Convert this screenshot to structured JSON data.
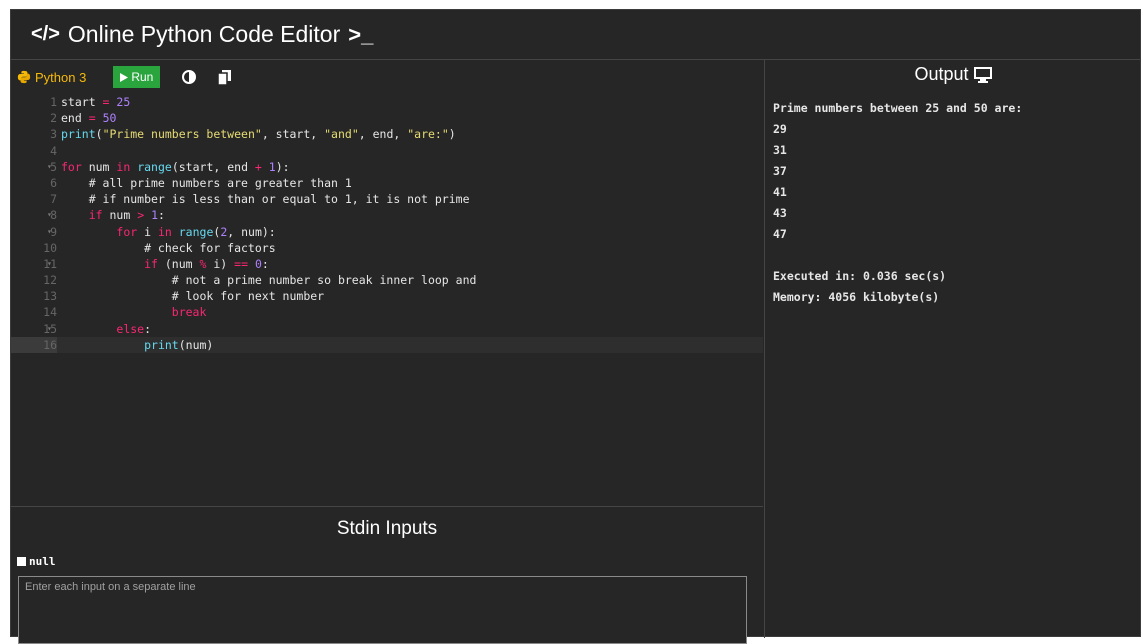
{
  "header": {
    "title": "Online Python Code Editor",
    "brand_icon": "</>",
    "terminal_icon": ">_"
  },
  "toolbar": {
    "language": "Python 3",
    "run_label": "Run"
  },
  "editor": {
    "lines": [
      {
        "n": "1",
        "fold": ""
      },
      {
        "n": "2",
        "fold": ""
      },
      {
        "n": "3",
        "fold": ""
      },
      {
        "n": "4",
        "fold": ""
      },
      {
        "n": "5",
        "fold": "▾"
      },
      {
        "n": "6",
        "fold": ""
      },
      {
        "n": "7",
        "fold": ""
      },
      {
        "n": "8",
        "fold": "▾"
      },
      {
        "n": "9",
        "fold": "▾"
      },
      {
        "n": "10",
        "fold": ""
      },
      {
        "n": "11",
        "fold": "▾"
      },
      {
        "n": "12",
        "fold": ""
      },
      {
        "n": "13",
        "fold": ""
      },
      {
        "n": "14",
        "fold": ""
      },
      {
        "n": "15",
        "fold": "▾"
      },
      {
        "n": "16",
        "fold": ""
      }
    ],
    "code": [
      "start = 25",
      "end = 50",
      "print(\"Prime numbers between\", start, \"and\", end, \"are:\")",
      "",
      "for num in range(start, end + 1):",
      "    # all prime numbers are greater than 1",
      "    # if number is less than or equal to 1, it is not prime",
      "    if num > 1:",
      "        for i in range(2, num):",
      "            # check for factors",
      "            if (num % i) == 0:",
      "                # not a prime number so break inner loop and",
      "                # look for next number",
      "                break",
      "        else:",
      "            print(num)"
    ]
  },
  "stdin": {
    "title": "Stdin Inputs",
    "null_label": "null",
    "placeholder": "Enter each input on a separate line"
  },
  "output": {
    "title": "Output",
    "lines": [
      "Prime numbers between 25 and 50 are:",
      "29",
      "31",
      "37",
      "41",
      "43",
      "47",
      "",
      "Executed in: 0.036 sec(s)",
      "Memory: 4056 kilobyte(s)"
    ]
  }
}
